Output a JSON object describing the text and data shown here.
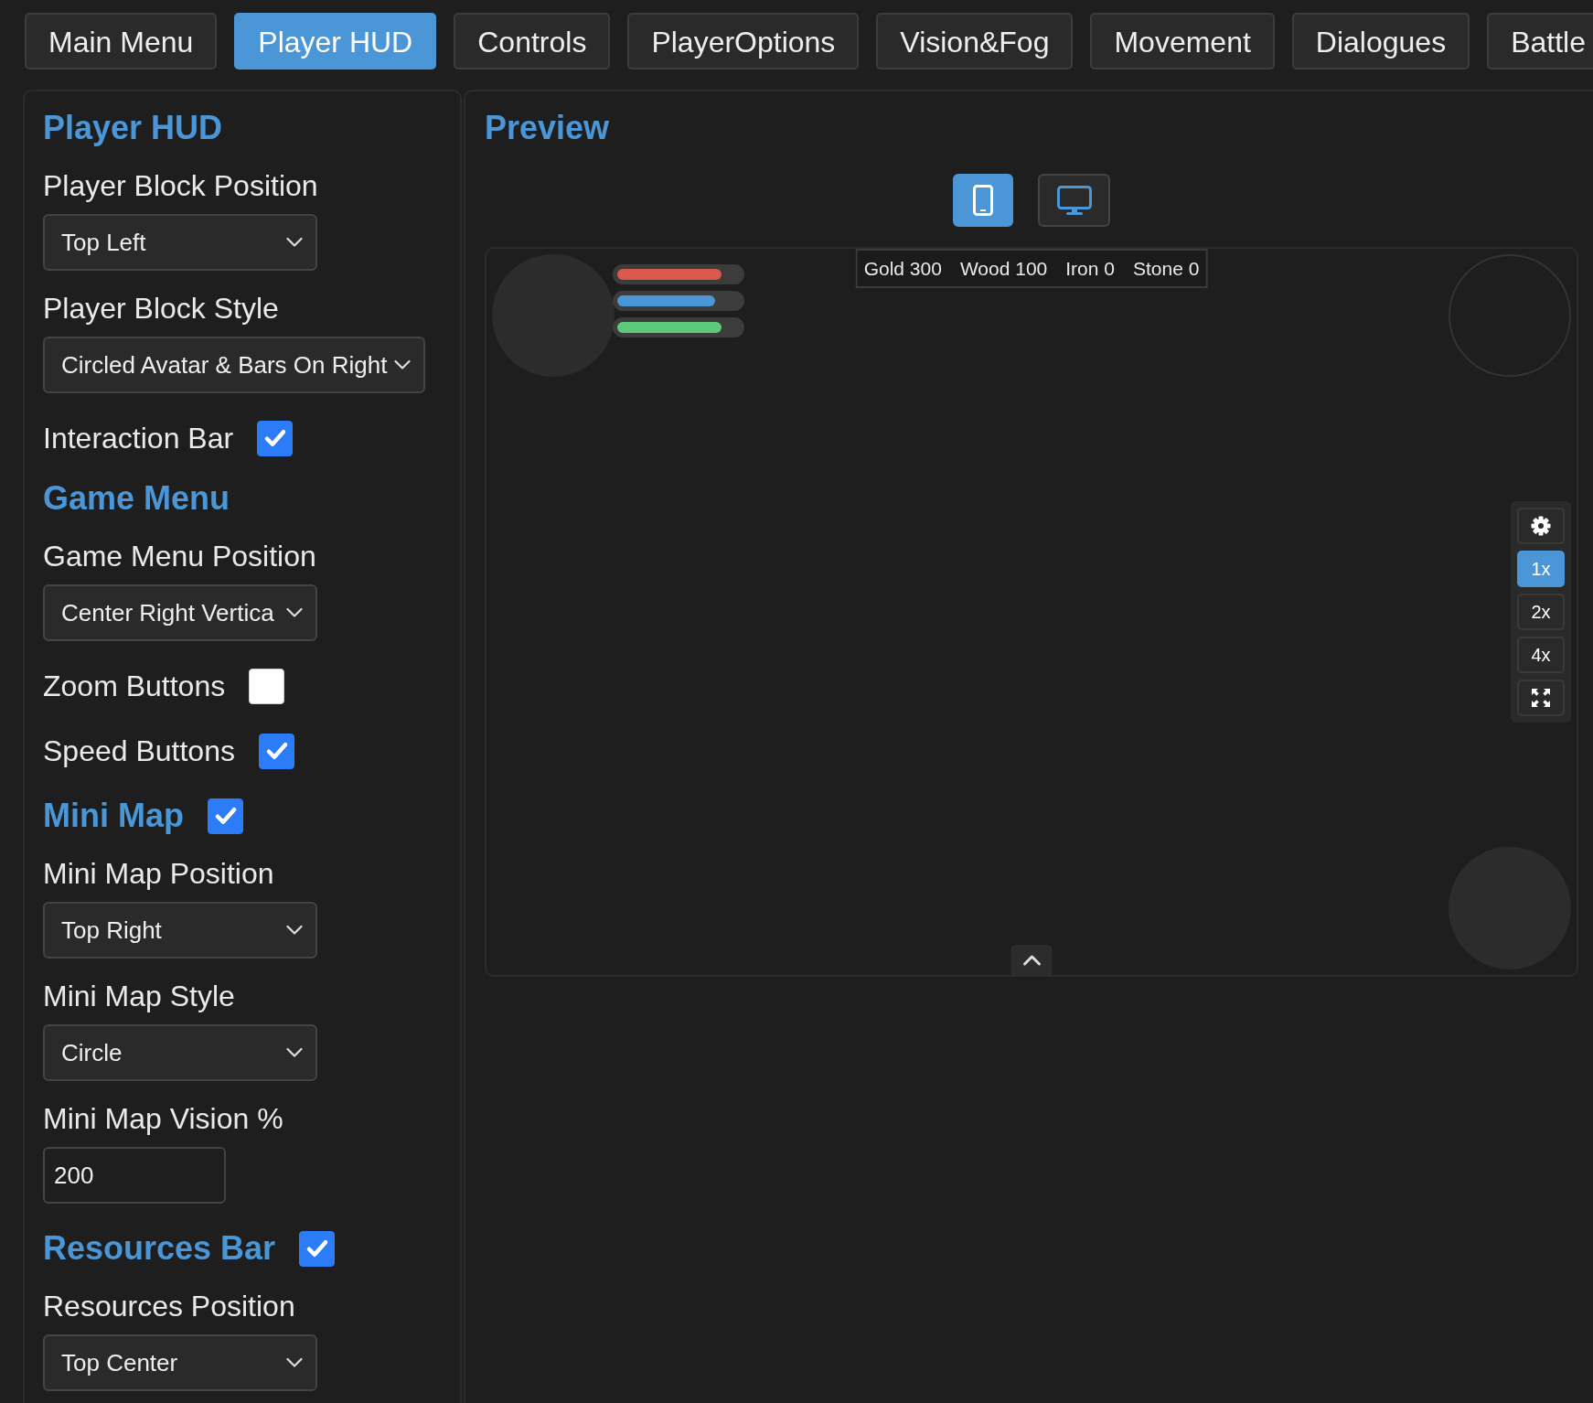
{
  "tabs": [
    {
      "label": "Main Menu",
      "selected": false
    },
    {
      "label": "Player HUD",
      "selected": true
    },
    {
      "label": "Controls",
      "selected": false
    },
    {
      "label": "PlayerOptions",
      "selected": false
    },
    {
      "label": "Vision&Fog",
      "selected": false
    },
    {
      "label": "Movement",
      "selected": false
    },
    {
      "label": "Dialogues",
      "selected": false
    },
    {
      "label": "Battle",
      "selected": false
    }
  ],
  "settings": {
    "title": "Player HUD",
    "items": [
      {
        "kind": "label",
        "text": "Player Block Position"
      },
      {
        "kind": "select",
        "value": "Top Left"
      },
      {
        "kind": "label",
        "text": "Player Block Style"
      },
      {
        "kind": "select",
        "value": "Circled Avatar & Bars On Right"
      },
      {
        "kind": "checkbox",
        "label": "Interaction Bar",
        "checked": true
      },
      {
        "kind": "heading",
        "text": "Game Menu"
      },
      {
        "kind": "label",
        "text": "Game Menu Position"
      },
      {
        "kind": "select",
        "value": "Center Right Vertica"
      },
      {
        "kind": "checkbox",
        "label": "Zoom Buttons",
        "checked": false
      },
      {
        "kind": "checkbox",
        "label": "Speed Buttons",
        "checked": true
      },
      {
        "kind": "heading_checkbox",
        "label": "Mini Map",
        "checked": true
      },
      {
        "kind": "label",
        "text": "Mini Map Position"
      },
      {
        "kind": "select",
        "value": "Top Right"
      },
      {
        "kind": "label",
        "text": "Mini Map Style"
      },
      {
        "kind": "select",
        "value": "Circle"
      },
      {
        "kind": "label",
        "text": "Mini Map Vision %"
      },
      {
        "kind": "input",
        "value": "200"
      },
      {
        "kind": "heading_checkbox",
        "label": "Resources Bar",
        "checked": true
      },
      {
        "kind": "label",
        "text": "Resources Position"
      },
      {
        "kind": "select",
        "value": "Top Center"
      }
    ]
  },
  "preview": {
    "title": "Preview",
    "devices": [
      {
        "kind": "mobile",
        "selected": true
      },
      {
        "kind": "desktop",
        "selected": false
      }
    ],
    "player_bars": [
      {
        "color": "#d9594c",
        "level": 0.85
      },
      {
        "color": "#4a96d6",
        "level": 0.8
      },
      {
        "color": "#5fc97a",
        "level": 0.85
      }
    ],
    "resources": [
      "Gold 300",
      "Wood 100",
      "Iron 0",
      "Stone 0"
    ],
    "game_menu": [
      {
        "kind": "settings"
      },
      {
        "kind": "speed",
        "label": "1x",
        "selected": true
      },
      {
        "kind": "speed",
        "label": "2x",
        "selected": false
      },
      {
        "kind": "speed",
        "label": "4x",
        "selected": false
      },
      {
        "kind": "fullscreen"
      }
    ]
  }
}
